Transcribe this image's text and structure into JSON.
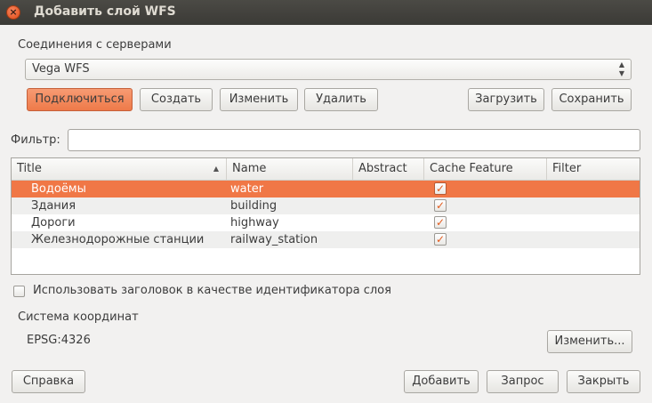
{
  "window": {
    "title": "Добавить слой WFS",
    "close_symbol": "×"
  },
  "connections": {
    "label": "Соединения с серверами",
    "selected": "Vega WFS",
    "connect": "Подключиться",
    "create": "Создать",
    "edit": "Изменить",
    "delete": "Удалить",
    "load": "Загрузить",
    "save": "Сохранить"
  },
  "filter": {
    "label": "Фильтр:",
    "value": ""
  },
  "table": {
    "columns": [
      "Title",
      "Name",
      "Abstract",
      "Cache Feature",
      "Filter"
    ],
    "sort_indicator": "▲",
    "rows": [
      {
        "title": "Водоёмы",
        "name": "water",
        "abstract": "",
        "cache": "✓",
        "filter": "",
        "selected": true
      },
      {
        "title": "Здания",
        "name": "building",
        "abstract": "",
        "cache": "✓",
        "filter": "",
        "selected": false
      },
      {
        "title": "Дороги",
        "name": "highway",
        "abstract": "",
        "cache": "✓",
        "filter": "",
        "selected": false
      },
      {
        "title": "Железнодорожные станции",
        "name": "railway_station",
        "abstract": "",
        "cache": "✓",
        "filter": "",
        "selected": false
      }
    ]
  },
  "options": {
    "use_title_as_id": "Использовать заголовок в качестве идентификатора слоя"
  },
  "crs": {
    "label": "Система координат",
    "value": "EPSG:4326",
    "change": "Изменить..."
  },
  "footer": {
    "help": "Справка",
    "add": "Добавить",
    "query": "Запрос",
    "close": "Закрыть"
  },
  "colors": {
    "accent": "#f07746",
    "titlebar": "#3c3b37"
  }
}
